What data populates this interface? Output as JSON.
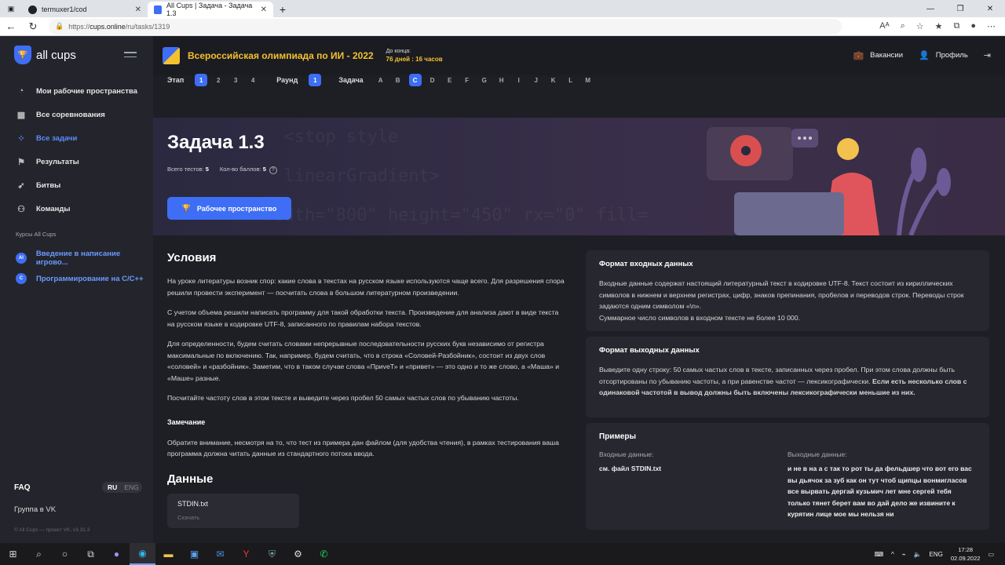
{
  "browser": {
    "tabs": [
      {
        "title": "termuxer1/cod",
        "active": false
      },
      {
        "title": "All Cups | Задача - Задача 1.3",
        "active": true
      }
    ],
    "url_prefix": "https://",
    "url_host": "cups.online",
    "url_path": "/ru/tasks/1319"
  },
  "sidebar": {
    "logo": "all cups",
    "items": [
      {
        "label": "Мои рабочие пространства",
        "icon": "workspace-icon"
      },
      {
        "label": "Все соревнования",
        "icon": "grid-icon"
      },
      {
        "label": "Все задачи",
        "icon": "tasks-icon",
        "active": true
      },
      {
        "label": "Результаты",
        "icon": "flag-icon"
      },
      {
        "label": "Битвы",
        "icon": "rocket-icon"
      },
      {
        "label": "Команды",
        "icon": "team-icon"
      }
    ],
    "courses_title": "Курсы All Cups",
    "courses": [
      {
        "label": "Введение в написание игрово...",
        "badge": "AI"
      },
      {
        "label": "Программирование на C/C++",
        "badge": "C"
      }
    ],
    "faq": "FAQ",
    "lang_ru": "RU",
    "lang_eng": "ENG",
    "vk_group": "Группа в VK",
    "copyright": "© All Cups — проект VK, v3.31.3"
  },
  "header": {
    "olympiad": "Всероссийская олимпиада по ИИ - 2022",
    "deadline_label": "До конца:",
    "deadline_value": "76 дней : 16 часов",
    "vacancies": "Вакансии",
    "profile": "Профиль"
  },
  "filters": {
    "stage_label": "Этап",
    "stages": [
      "1",
      "2",
      "3",
      "4"
    ],
    "stage_selected": "1",
    "round_label": "Раунд",
    "rounds": [
      "1"
    ],
    "task_label": "Задача",
    "tasks": [
      "A",
      "B",
      "C",
      "D",
      "E",
      "F",
      "G",
      "H",
      "I",
      "J",
      "K",
      "L",
      "M"
    ],
    "task_selected": "C"
  },
  "task": {
    "title": "Задача 1.3",
    "tests_label": "Всего тестов:",
    "tests_value": "5",
    "score_label": "Кол-во баллов:",
    "score_value": "5",
    "workspace_button": "Рабочее пространство",
    "conditions_title": "Условия",
    "paragraphs": [
      "На уроке литературы возник спор: какие слова в текстах на русском языке используются чаще всего. Для разрешения спора решили провести эксперимент — посчитать слова в большом литературном произведении.",
      "С учетом объема решили написать программу для такой обработки текста. Произведение для анализа дают в виде текста на русском языке в кодировке UTF-8, записанного по правилам набора текстов.",
      "Для определенности, будем считать словами непрерывные последовательности русских букв независимо от регистра максимальные по включению. Так, например, будем считать, что в строка «Соловей-Разбойник», состоит из двух слов «соловей» и «разбойник». Заметим, что в таком случае слова «ПриveТ» и «привет» — это одно и то же слово, а «Маша» и «Маше» разные.",
      "Посчитайте частоту слов в этом тексте и выведите через пробел 50 самых частых слов по убыванию частоты."
    ],
    "note_title": "Замечание",
    "note_text": "Обратите внимание, несмотря на то, что тест из примера дан файлом (для удобства чтения), в рамках тестирования ваша программа должна читать данные из стандартного потока ввода.",
    "data_title": "Данные",
    "file_name": "STDIN.txt",
    "file_download": "Скачать"
  },
  "input_format": {
    "title": "Формат входных данных",
    "text": "Входные данные содержат настоящий литературный текст в кодировке UTF-8. Текст состоит из кириллических символов в нижнем и верхнем регистрах, цифр, знаков препинания, пробелов и переводов строк. Переводы строк задаются одним символом «\\n».",
    "text2": "Суммарное число символов в входном тексте не более 10 000."
  },
  "output_format": {
    "title": "Формат выходных данных",
    "text": "Выведите одну строку: 50 самых частых слов в тексте, записанных через пробел. При этом слова должны быть отсортированы по убыванию частоты, а при равенстве частот — лексикографически.",
    "text_bold": "Если есть несколько слов с одинаковой частотой в вывод должны быть включены лексикографически меньшие из них."
  },
  "examples": {
    "title": "Примеры",
    "input_label": "Входные данные:",
    "input_value": "см. файл STDIN.txt",
    "output_label": "Выходные данные:",
    "output_value": "и не в на а с так то рот ты да фельдшер что вот его вас вы дьячок за зуб как он тут чтоб щипцы вонмигласов все вырвать дергай кузьмич лет мне сергей тебя только тянет берет вам во дай дело же извините к курятин лице мое мы нельзя ни"
  },
  "taskbar": {
    "lang": "ENG",
    "time": "17:28",
    "date": "02.09.2022"
  }
}
